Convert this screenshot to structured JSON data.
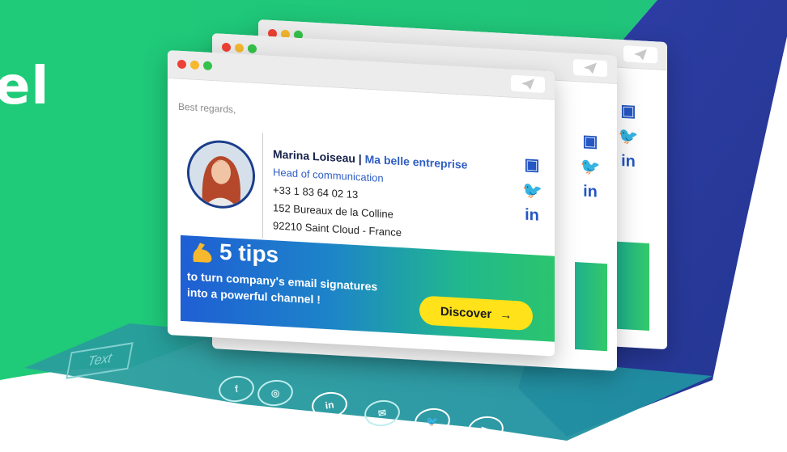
{
  "headline": "el",
  "window": {
    "greeting": "Best regards,",
    "signature": {
      "name": "Marina Loiseau",
      "separator": " | ",
      "company": "Ma belle entreprise",
      "role": "Head of communication",
      "phone": "+33 1 83 64 02 13",
      "address_line1": "152 Bureaux de la Colline",
      "address_line2": "92210 Saint Cloud - France"
    },
    "social_icons": [
      "contact-card-icon",
      "twitter-icon",
      "linkedin-icon"
    ],
    "banner": {
      "title": "5 tips",
      "subtitle_line1": "to turn company's email signatures",
      "subtitle_line2": "into a powerful channel !",
      "cta_label": "Discover",
      "cta_arrow": "→"
    }
  },
  "floor": {
    "text_placeholder": "Text",
    "linkedin_label": "in"
  },
  "colors": {
    "green": "#22c77b",
    "blue_dark": "#2a3aa0",
    "accent_blue": "#2456c4",
    "cta_yellow": "#ffe21a"
  }
}
